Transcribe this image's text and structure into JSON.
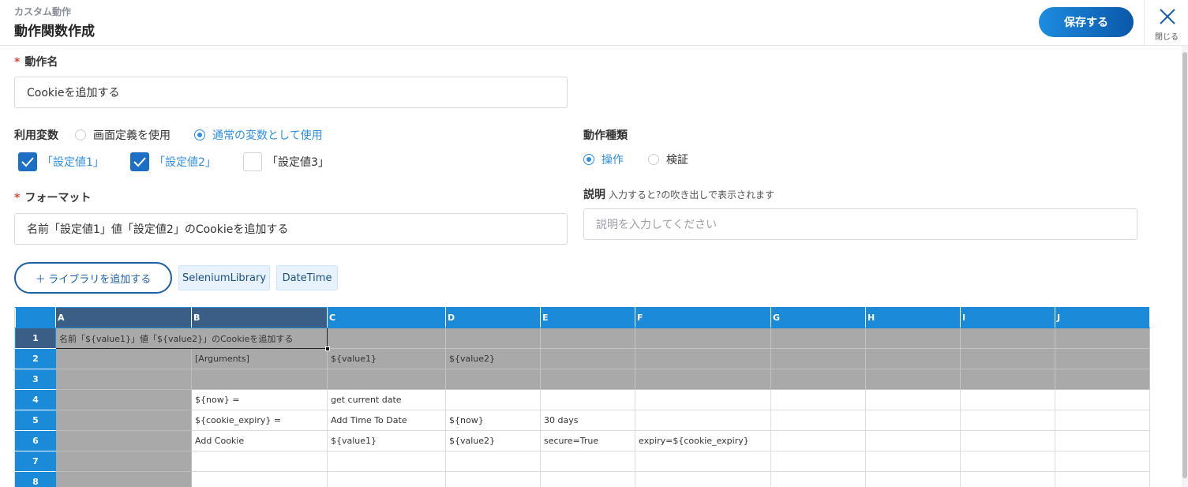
{
  "header": {
    "subtitle": "カスタム動作",
    "title": "動作関数作成",
    "save_label": "保存する",
    "close_label": "閉じる"
  },
  "form": {
    "action_name_label": "動作名",
    "action_name_value": "Cookieを追加する",
    "variables_label": "利用変数",
    "variables_options": [
      "画面定義を使用",
      "通常の変数として使用"
    ],
    "variables_selected": "通常の変数として使用",
    "setting_checks": [
      {
        "label": "「設定値1」",
        "checked": true
      },
      {
        "label": "「設定値2」",
        "checked": true
      },
      {
        "label": "「設定値3」",
        "checked": false
      }
    ],
    "format_label": "フォーマット",
    "format_value": "名前「設定値1」値「設定値2」のCookieを追加する",
    "action_type_label": "動作種類",
    "action_type_options": [
      "操作",
      "検証"
    ],
    "action_type_selected": "操作",
    "description_label": "説明",
    "description_hint": "入力すると?の吹き出しで表示されます",
    "description_placeholder": "説明を入力してください",
    "add_library_label": "＋ ライブラリを追加する",
    "libraries": [
      "SeleniumLibrary",
      "DateTime"
    ]
  },
  "grid": {
    "columns": [
      "A",
      "B",
      "C",
      "D",
      "E",
      "F",
      "G",
      "H",
      "I",
      "J"
    ],
    "rows": [
      {
        "num": "1",
        "cells": [
          "名前「${value1}」値「${value2}」のCookieを追加する",
          "",
          "",
          "",
          "",
          "",
          "",
          "",
          "",
          ""
        ]
      },
      {
        "num": "2",
        "cells": [
          "",
          "[Arguments]",
          "${value1}",
          "${value2}",
          "",
          "",
          "",
          "",
          "",
          ""
        ]
      },
      {
        "num": "3",
        "cells": [
          "",
          "",
          "",
          "",
          "",
          "",
          "",
          "",
          "",
          ""
        ]
      },
      {
        "num": "4",
        "cells": [
          "",
          "${now} =",
          "get current date",
          "",
          "",
          "",
          "",
          "",
          "",
          ""
        ]
      },
      {
        "num": "5",
        "cells": [
          "",
          "${cookie_expiry} =",
          "Add Time To Date",
          "${now}",
          "30 days",
          "",
          "",
          "",
          "",
          ""
        ]
      },
      {
        "num": "6",
        "cells": [
          "",
          "Add Cookie",
          "${value1}",
          "${value2}",
          "secure=True",
          "expiry=${cookie_expiry}",
          "",
          "",
          "",
          ""
        ]
      },
      {
        "num": "7",
        "cells": [
          "",
          "",
          "",
          "",
          "",
          "",
          "",
          "",
          "",
          ""
        ]
      },
      {
        "num": "8",
        "cells": [
          "",
          "",
          "",
          "",
          "",
          "",
          "",
          "",
          "",
          ""
        ]
      }
    ]
  },
  "colors": {
    "accent": "#2f8ee5",
    "grid_header": "#1a8ad9",
    "grid_selected_header": "#3a5e86",
    "required": "#e0473a"
  }
}
